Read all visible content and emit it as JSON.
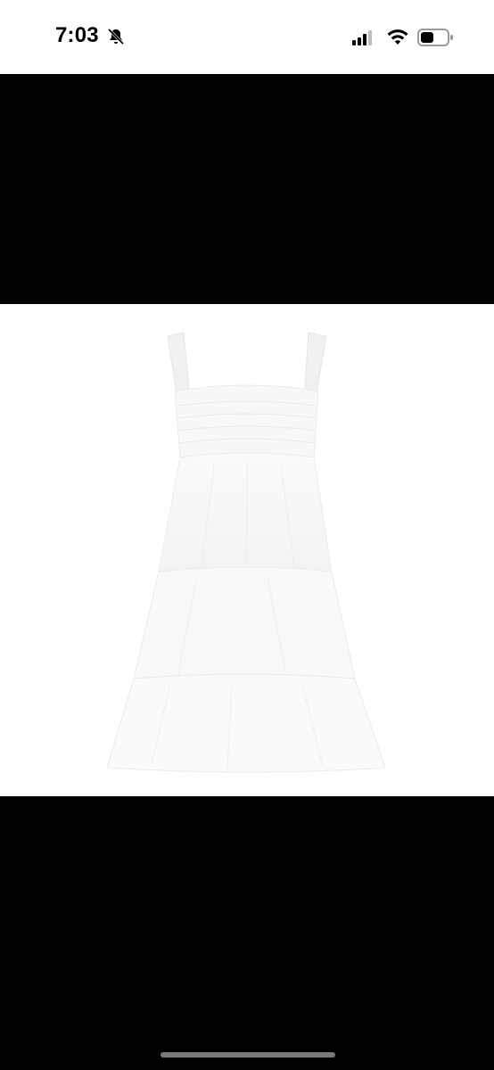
{
  "status_bar": {
    "time": "7:03",
    "icons": [
      "bell-slash-icon",
      "cellular-signal-icon",
      "wifi-icon",
      "battery-icon"
    ]
  },
  "viewer": {
    "background": "#000000",
    "image_subject": "white-tiered-smocked-dress"
  }
}
